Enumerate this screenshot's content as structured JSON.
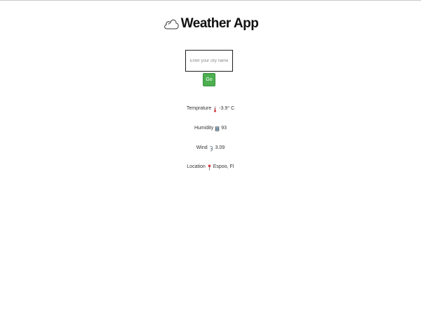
{
  "header": {
    "title": "Weather App",
    "icon": "cloud-icon"
  },
  "search": {
    "placeholder": "Enter your city name",
    "value": ""
  },
  "go_button": {
    "label": "Go",
    "color": "#4caf50"
  },
  "weather": {
    "temperature": {
      "label": "Temprature",
      "icon": "thermometer-icon",
      "value": "-3.9° C"
    },
    "humidity": {
      "label": "Humidity",
      "icon": "humidity-icon",
      "value": "93"
    },
    "wind": {
      "label": "Wind",
      "icon": "wind-icon",
      "value": "3.09"
    },
    "location": {
      "label": "Location",
      "icon": "pin-icon",
      "value": "Espoo, FI"
    }
  }
}
